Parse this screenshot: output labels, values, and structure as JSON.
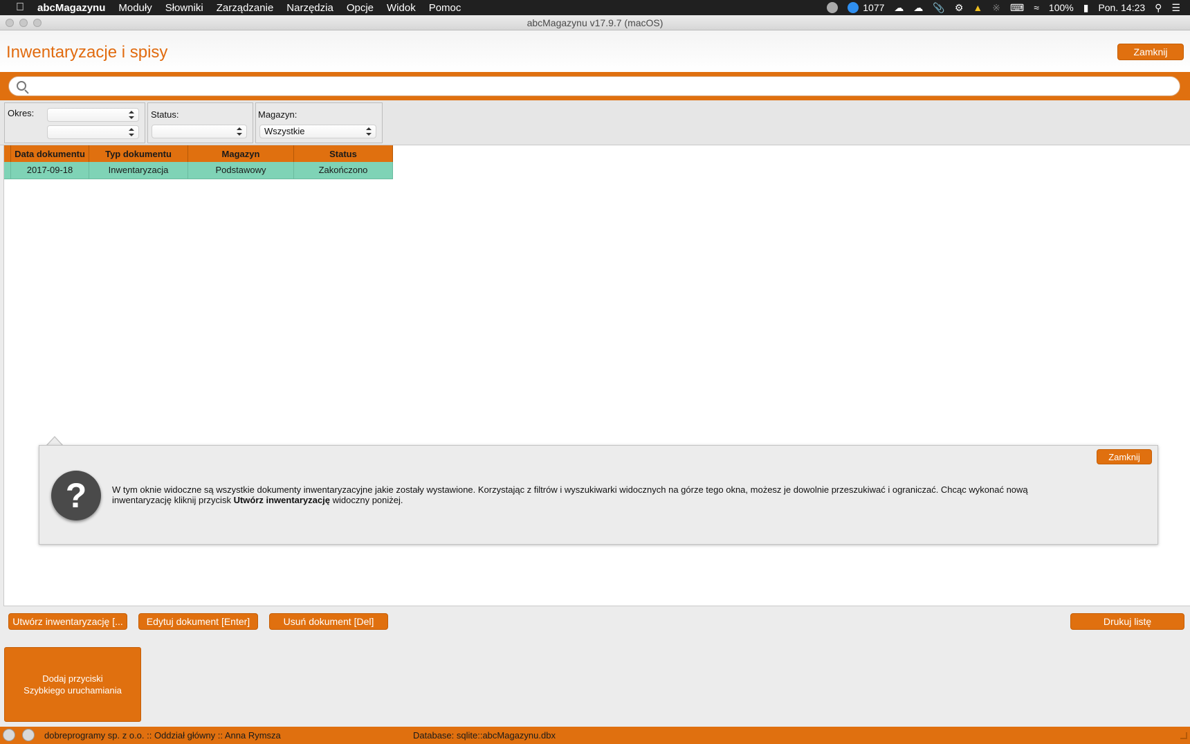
{
  "menubar": {
    "app_name": "abcMagazynu",
    "items": [
      "Moduły",
      "Słowniki",
      "Zarządzanie",
      "Narzędzia",
      "Opcje",
      "Widok",
      "Pomoc"
    ],
    "badge_count": "1077",
    "battery": "100%",
    "clock": "Pon. 14:23"
  },
  "window": {
    "title": "abcMagazynu v17.9.7 (macOS)"
  },
  "header": {
    "title": "Inwentaryzacje i spisy",
    "close_label": "Zamknij"
  },
  "search": {
    "placeholder": "",
    "value": ""
  },
  "filters": {
    "okres_label": "Okres:",
    "okres_from": "",
    "okres_to": "",
    "status_label": "Status:",
    "status_value": "",
    "magazyn_label": "Magazyn:",
    "magazyn_value": "Wszystkie"
  },
  "table": {
    "columns": [
      "Data dokumentu",
      "Typ dokumentu",
      "Magazyn",
      "Status"
    ],
    "rows": [
      [
        "2017-09-18",
        "Inwentaryzacja",
        "Podstawowy",
        "Zakończono"
      ]
    ]
  },
  "help": {
    "close_label": "Zamknij",
    "text_part1": "W tym oknie widoczne są wszystkie dokumenty inwentaryzacyjne jakie zostały wystawione. Korzystając z filtrów i wyszukiwarki widocznych na górze tego okna,  możesz je dowolnie przeszukiwać i ograniczać. Chcąc wykonać nową inwentaryzację kliknij przycisk ",
    "text_bold": "Utwórz inwentaryzację",
    "text_part2": " widoczny poniżej."
  },
  "actions": {
    "create_label": "Utwórz inwentaryzację [...",
    "edit_label": "Edytuj dokument [Enter]",
    "delete_label": "Usuń dokument [Del]",
    "print_label": "Drukuj listę"
  },
  "quick_launch": {
    "line1": "Dodaj przyciski",
    "line2": "Szybkiego uruchamiania"
  },
  "statusbar": {
    "company": "dobreprogramy sp. z o.o. :: Oddział główny :: Anna Rymsza",
    "database": "Database: sqlite::abcMagazynu.dbx"
  },
  "colors": {
    "accent": "#e0700f",
    "row_highlight": "#7fd3b6",
    "title": "#e16b0f"
  }
}
